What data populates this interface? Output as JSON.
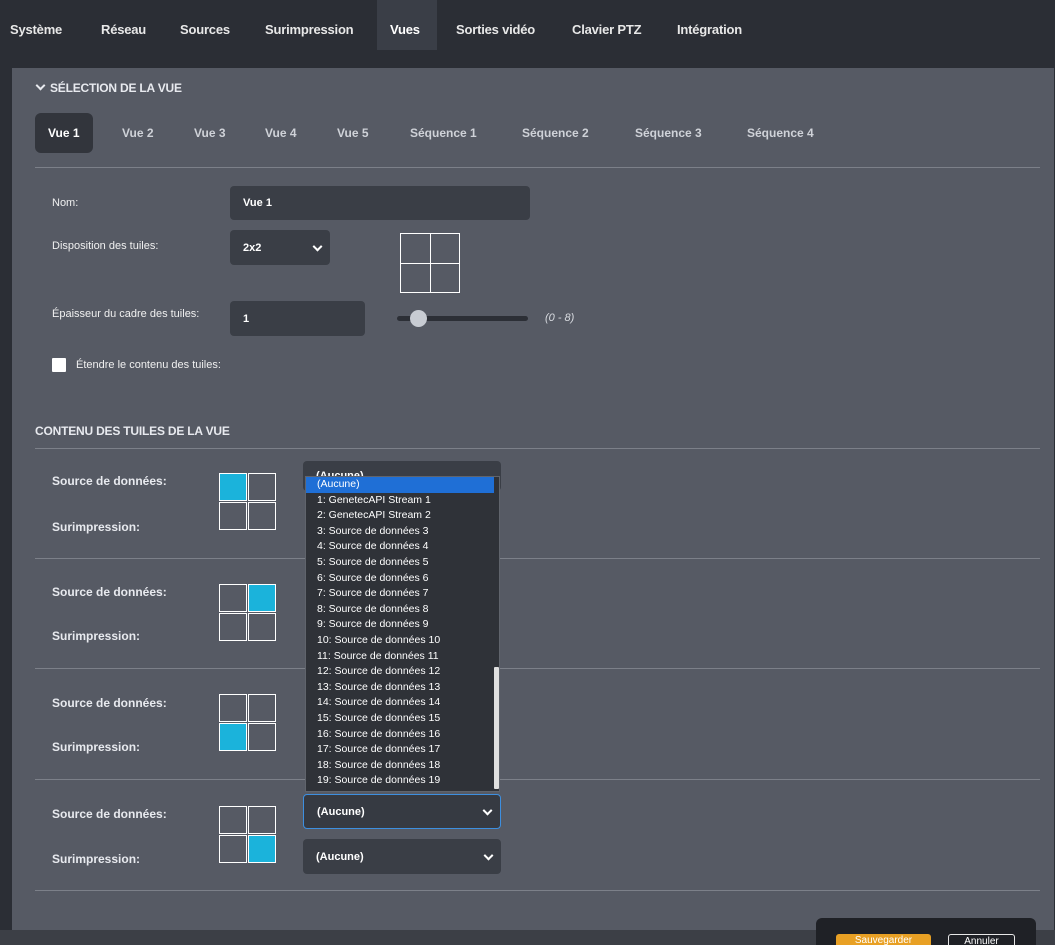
{
  "topnav": {
    "tabs": [
      "Système",
      "Réseau",
      "Sources",
      "Surimpression",
      "Vues",
      "Sorties vidéo",
      "Clavier PTZ",
      "Intégration"
    ],
    "active": "Vues"
  },
  "selection": {
    "heading": "SÉLECTION DE LA VUE",
    "tabs": [
      "Vue 1",
      "Vue 2",
      "Vue 3",
      "Vue 4",
      "Vue 5",
      "Séquence 1",
      "Séquence 2",
      "Séquence 3",
      "Séquence 4"
    ],
    "active_tab": "Vue 1"
  },
  "form": {
    "name_label": "Nom:",
    "name_value": "Vue 1",
    "layout_label": "Disposition des tuiles:",
    "layout_value": "2x2",
    "thickness_label": "Épaisseur du cadre des tuiles:",
    "thickness_value": "1",
    "thickness_range": "(0 - 8)",
    "thickness_slider_fraction": 0.125,
    "stretch_label": "Étendre le contenu des tuiles:",
    "stretch_checked": false
  },
  "content": {
    "heading": "CONTENU DES TUILES DE LA VUE",
    "source_label": "Source de données:",
    "overlay_label": "Surimpression:",
    "rows": [
      {
        "active_cell": "top-left",
        "source": "(Aucune)",
        "overlay": ""
      },
      {
        "active_cell": "top-right",
        "source": "",
        "overlay": ""
      },
      {
        "active_cell": "bottom-left",
        "source": "",
        "overlay": ""
      },
      {
        "active_cell": "bottom-right",
        "source": "(Aucune)",
        "overlay": "(Aucune)"
      }
    ],
    "dropdown_options": [
      "(Aucune)",
      "1: GenetecAPI Stream 1",
      "2: GenetecAPI Stream 2",
      "3: Source de données 3",
      "4: Source de données 4",
      "5: Source de données 5",
      "6: Source de données 6",
      "7: Source de données 7",
      "8: Source de données 8",
      "9: Source de données 9",
      "10: Source de données 10",
      "11: Source de données 11",
      "12: Source de données 12",
      "13: Source de données 13",
      "14: Source de données 14",
      "15: Source de données 15",
      "16: Source de données 16",
      "17: Source de données 17",
      "18: Source de données 18",
      "19: Source de données 19"
    ],
    "dropdown_selected": "(Aucune)"
  },
  "actions": {
    "save": "Sauvegarder",
    "cancel": "Annuler"
  },
  "colors": {
    "accent_tile": "#1bb3db",
    "save_button": "#e8a024",
    "selected_option": "#1f6fd6"
  }
}
